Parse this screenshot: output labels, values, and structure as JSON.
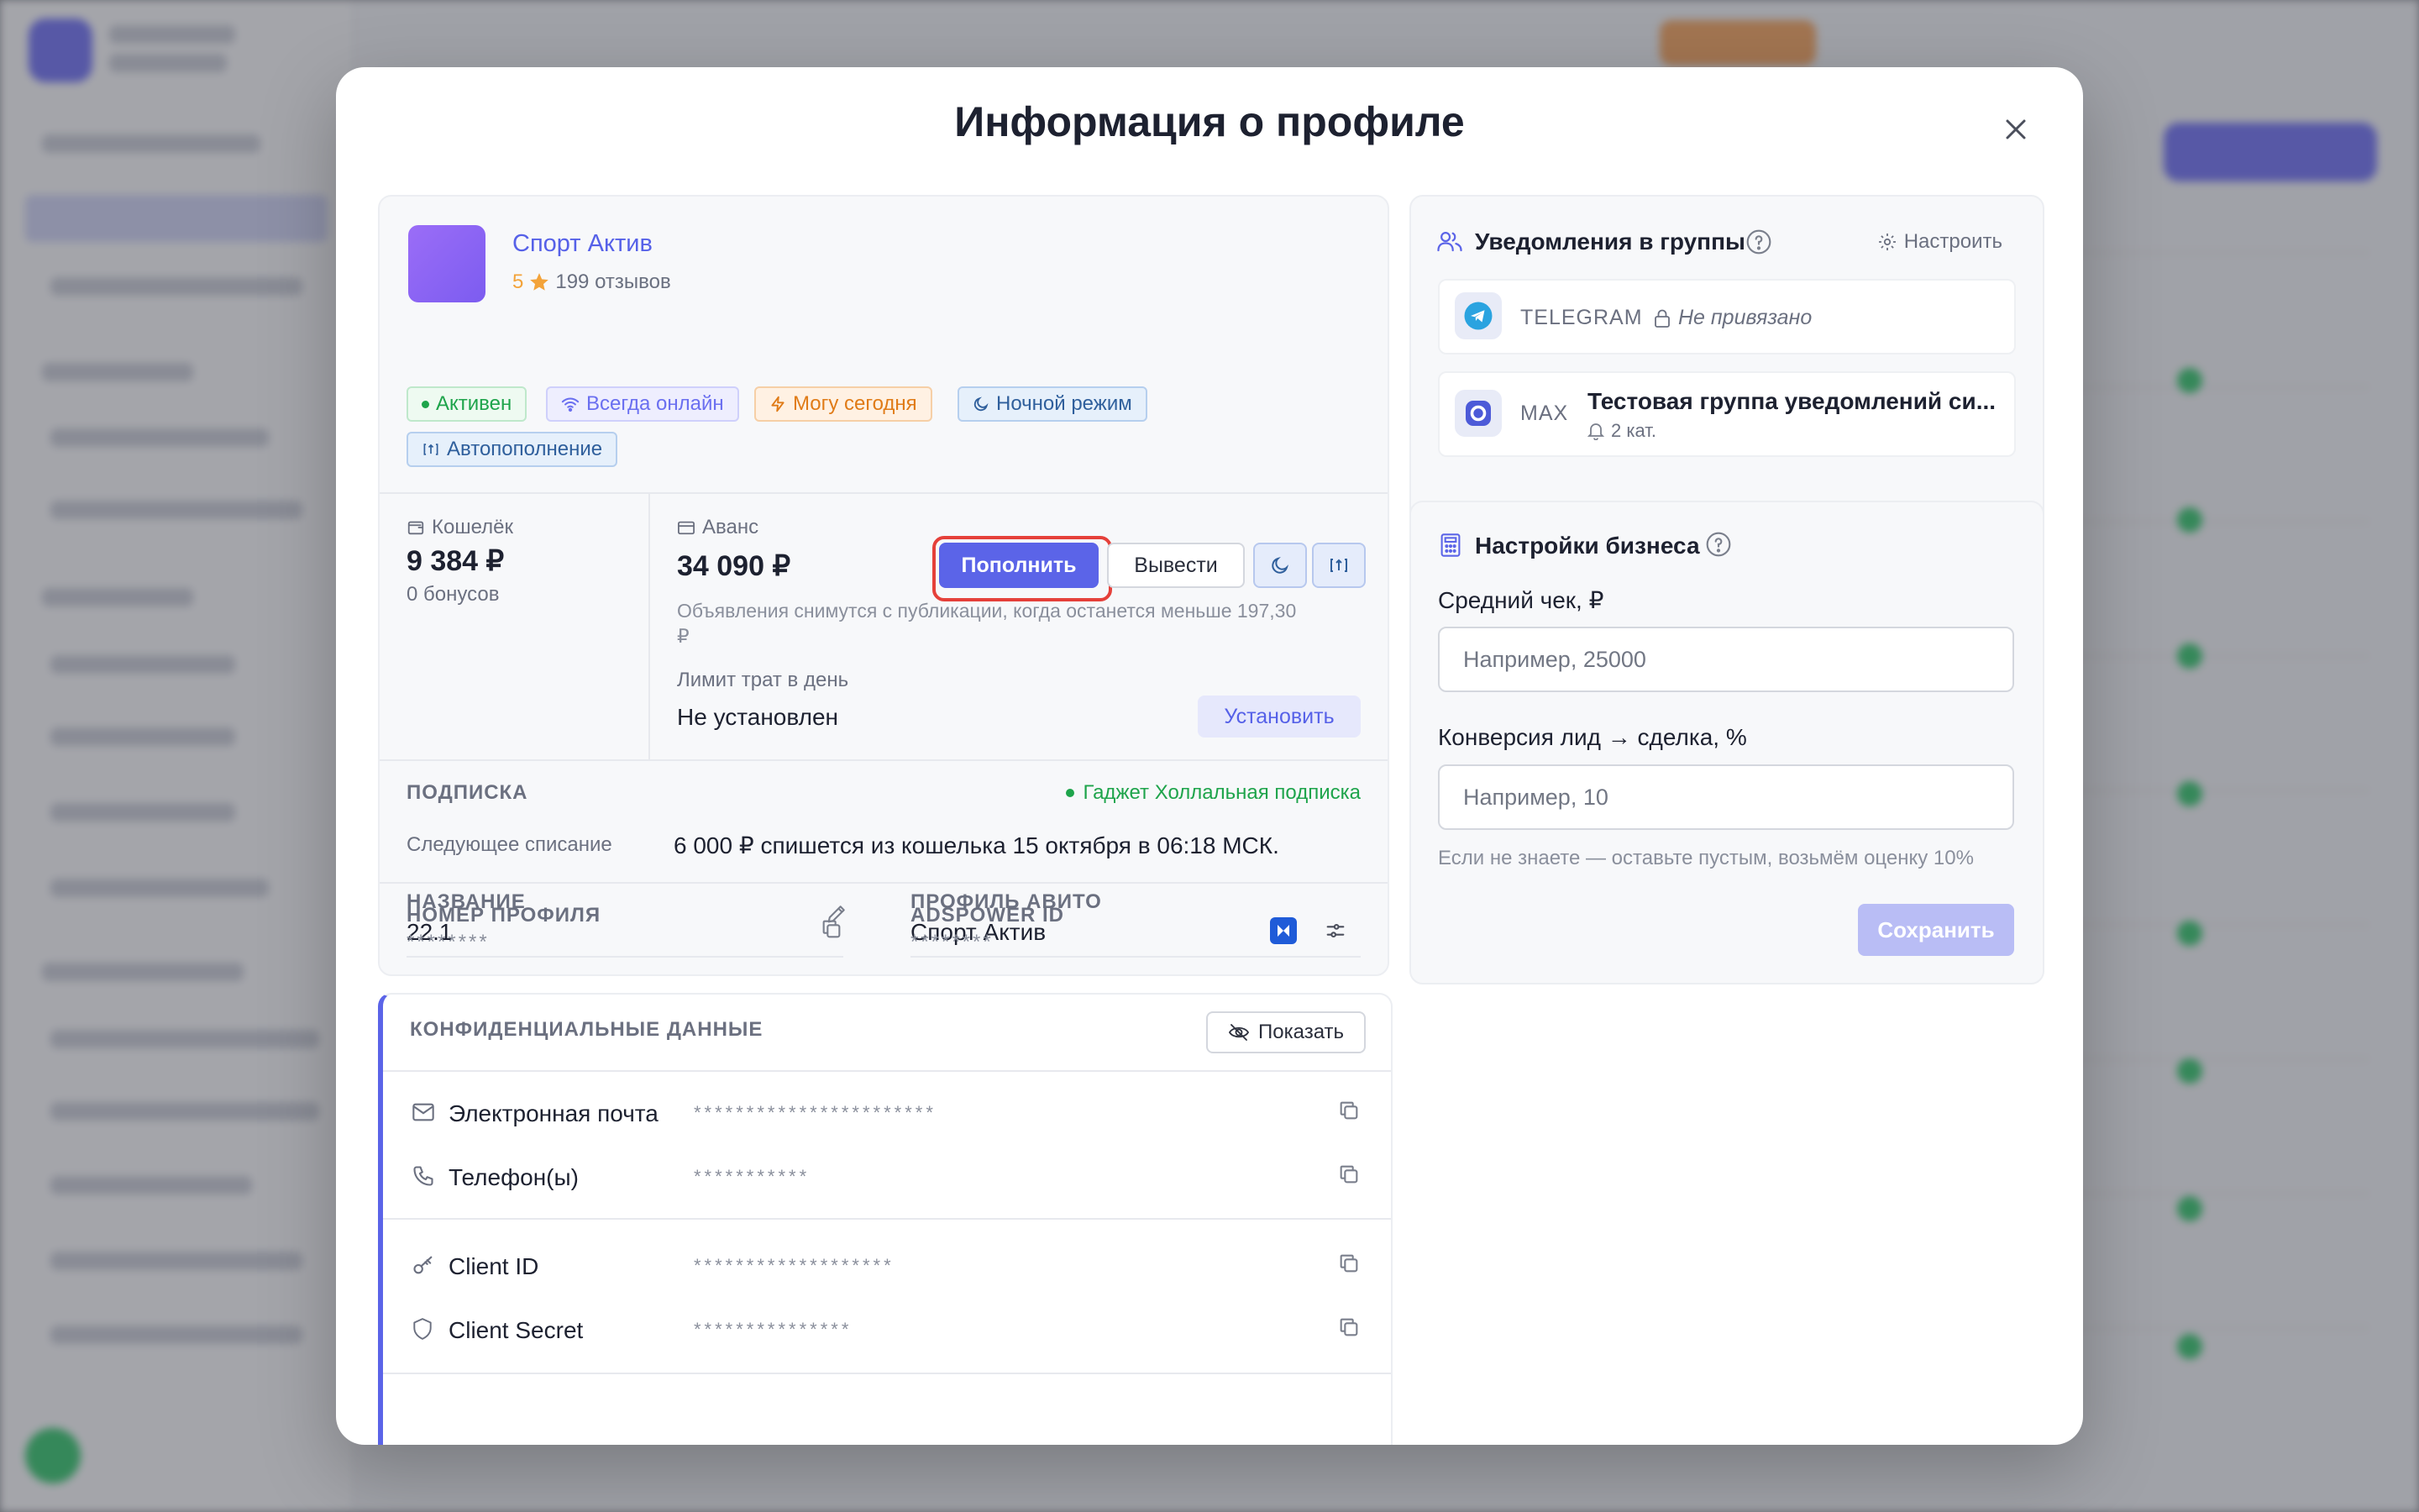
{
  "modal": {
    "title": "Информация о профиле"
  },
  "profile": {
    "name": "Спорт Актив",
    "rating": "5",
    "reviews": "199 отзывов",
    "badges": {
      "active": "Активен",
      "online": "Всегда онлайн",
      "today": "Могу сегодня",
      "night": "Ночной режим",
      "autofill": "Автопополнение"
    }
  },
  "wallet": {
    "label": "Кошелёк",
    "amount": "9 384 ₽",
    "bonus": "0 бонусов"
  },
  "advance": {
    "label": "Аванс",
    "amount": "34 090 ₽",
    "topup_label": "Пополнить",
    "withdraw_label": "Вывести",
    "note_line1": "Объявления снимутся с публикации, когда останется меньше 197,30",
    "note_line2": "₽",
    "limit_label": "Лимит трат в день",
    "limit_value": "Не установлен",
    "set_label": "Установить"
  },
  "subscription": {
    "title": "ПОДПИСКА",
    "plan": "Гаджет Холлальная подписка",
    "next_label": "Следующее списание",
    "next_value": "6 000 ₽ спишется из кошелька 15 октября в 06:18 МСК."
  },
  "details": {
    "name_label": "НАЗВАНИЕ",
    "name_value": "22.1",
    "avito_label": "ПРОФИЛЬ АВИТО",
    "avito_value": "Спорт Актив",
    "number_label": "НОМЕР ПРОФИЛЯ",
    "number_value": "********",
    "adspower_label": "ADSPOWER ID",
    "adspower_value": "********"
  },
  "confidential": {
    "title": "КОНФИДЕНЦИАЛЬНЫЕ ДАННЫЕ",
    "show_label": "Показать",
    "email_label": "Электронная почта",
    "email_value": "***********************",
    "phone_label": "Телефон(ы)",
    "phone_value": "***********",
    "client_id_label": "Client ID",
    "client_id_value": "*******************",
    "client_secret_label": "Client Secret",
    "client_secret_value": "***************"
  },
  "notifications": {
    "title": "Уведомления в группы",
    "configure_label": "Настроить",
    "telegram_label": "TELEGRAM",
    "telegram_status": "Не привязано",
    "max_label": "MAX",
    "max_group": "Тестовая группа уведомлений си...",
    "max_categories": "2 кат."
  },
  "business": {
    "title": "Настройки бизнеса",
    "avg_check_label": "Средний чек, ₽",
    "avg_check_placeholder": "Например, 25000",
    "avg_check_value": "",
    "conversion_label": "Конверсия лид → сделка, %",
    "conversion_placeholder": "Например, 10",
    "conversion_value": "",
    "hint": "Если не знаете — оставьте пустым, возьмём оценку 10%",
    "save_label": "Сохранить"
  },
  "colors": {
    "accent": "#5b64e8",
    "success": "#1ea44b",
    "warning": "#e07b17",
    "focus": "#e5403a"
  }
}
